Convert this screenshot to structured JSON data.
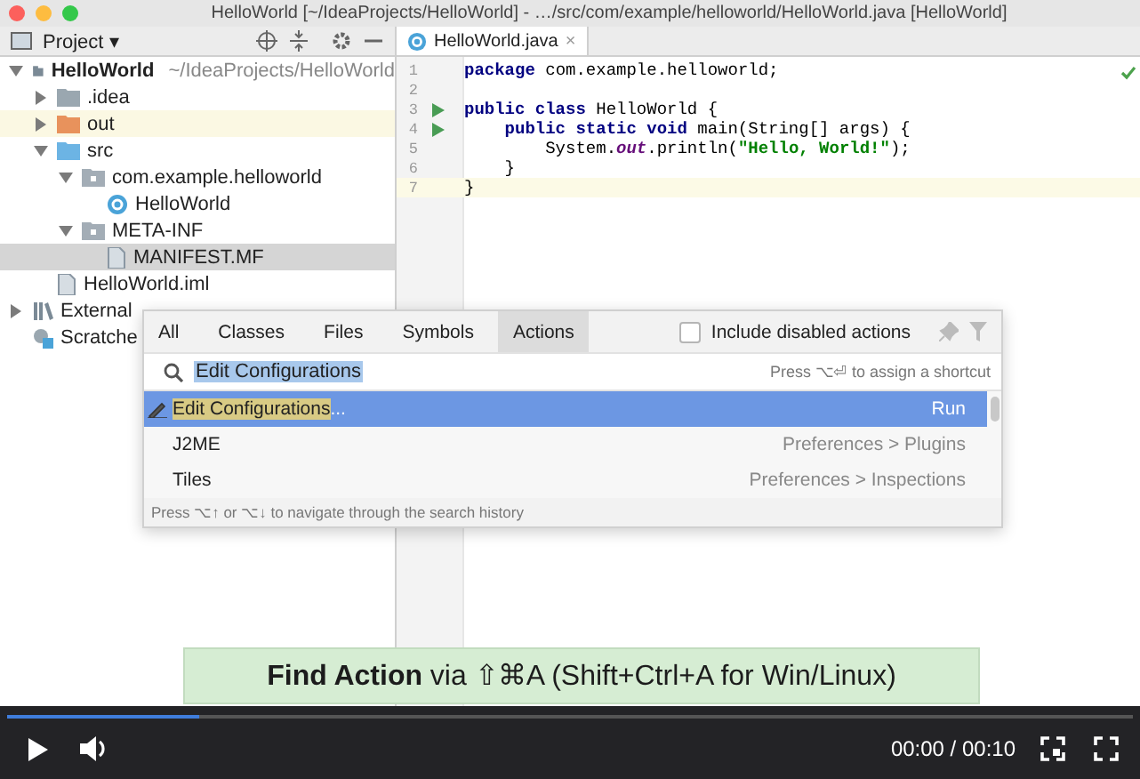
{
  "window": {
    "title": "HelloWorld [~/IdeaProjects/HelloWorld] - …/src/com/example/helloworld/HelloWorld.java [HelloWorld]"
  },
  "project_panel": {
    "title": "Project ▾",
    "tree": [
      {
        "label": "HelloWorld",
        "path": "~/IdeaProjects/HelloWorld",
        "kind": "module",
        "expanded": true,
        "selected": false,
        "children": [
          {
            "label": ".idea",
            "kind": "folder",
            "expanded": false,
            "selected": false
          },
          {
            "label": "out",
            "kind": "excluded",
            "expanded": false,
            "selected": false
          },
          {
            "label": "src",
            "kind": "source",
            "expanded": true,
            "selected": false,
            "children": [
              {
                "label": "com.example.helloworld",
                "kind": "package",
                "expanded": true,
                "selected": false,
                "children": [
                  {
                    "label": "HelloWorld",
                    "kind": "class",
                    "selected": false
                  }
                ]
              },
              {
                "label": "META-INF",
                "kind": "package",
                "expanded": true,
                "selected": false,
                "children": [
                  {
                    "label": "MANIFEST.MF",
                    "kind": "file",
                    "selected": true
                  }
                ]
              }
            ]
          },
          {
            "label": "HelloWorld.iml",
            "kind": "iml",
            "selected": false
          }
        ]
      },
      {
        "label": "External",
        "kind": "libraries",
        "expanded": false,
        "selected": false
      },
      {
        "label": "Scratche",
        "kind": "scratches",
        "selected": false
      }
    ]
  },
  "editor": {
    "tab": {
      "label": "HelloWorld.java",
      "close": "×"
    },
    "lines": [
      {
        "number": "1",
        "run": false,
        "current": false,
        "tokens": [
          {
            "text": "package",
            "kind": "keyword"
          },
          {
            "text": " com.example.helloworld;",
            "kind": "plain"
          }
        ]
      },
      {
        "number": "2",
        "run": false,
        "current": false
      },
      {
        "number": "3",
        "run": true,
        "current": false,
        "tokens": [
          {
            "text": "public class",
            "kind": "keyword"
          },
          {
            "text": " HelloWorld {",
            "kind": "plain"
          }
        ]
      },
      {
        "number": "4",
        "run": true,
        "current": false,
        "tokens": [
          {
            "text": "    public static void",
            "kind": "keyword"
          },
          {
            "text": " main(String[] args) {",
            "kind": "plain"
          }
        ]
      },
      {
        "number": "5",
        "run": false,
        "current": false,
        "tokens": [
          {
            "text": "        System.",
            "kind": "plain"
          },
          {
            "text": "out",
            "kind": "field"
          },
          {
            "text": ".println(",
            "kind": "plain"
          },
          {
            "text": "\"Hello, World!\"",
            "kind": "string"
          },
          {
            "text": ");",
            "kind": "plain"
          }
        ]
      },
      {
        "number": "6",
        "run": false,
        "current": false,
        "tokens": [
          {
            "text": "    }",
            "kind": "plain"
          }
        ]
      },
      {
        "number": "7",
        "run": false,
        "current": true,
        "tokens": [
          {
            "text": "}",
            "kind": "plain"
          }
        ]
      }
    ]
  },
  "search_popup": {
    "tabs": [
      {
        "label": "All",
        "selected": false
      },
      {
        "label": "Classes",
        "selected": false
      },
      {
        "label": "Files",
        "selected": false
      },
      {
        "label": "Symbols",
        "selected": false
      },
      {
        "label": "Actions",
        "selected": true
      }
    ],
    "include_disabled": {
      "label": "Include disabled actions",
      "checked": false
    },
    "query": "Edit Configurations",
    "hint": "Press ⌥⏎ to assign a shortcut",
    "results": [
      {
        "parts": [
          {
            "text": "Edit Configurations",
            "match": true
          },
          {
            "text": "...",
            "match": false
          }
        ],
        "location": "Run",
        "selected": true
      },
      {
        "parts": [
          {
            "text": "J2ME",
            "match": false
          }
        ],
        "location": "Preferences > Plugins",
        "selected": false
      },
      {
        "parts": [
          {
            "text": "Tiles",
            "match": false
          }
        ],
        "location": "Preferences > Inspections",
        "selected": false
      }
    ],
    "footer": "Press ⌥↑ or ⌥↓ to navigate through the search history"
  },
  "caption": "**Find Action** via ⇧⌘A (Shift+Ctrl+A for Win/Linux)",
  "player": {
    "level": 0.17,
    "time": "00:00 / 00:10"
  }
}
